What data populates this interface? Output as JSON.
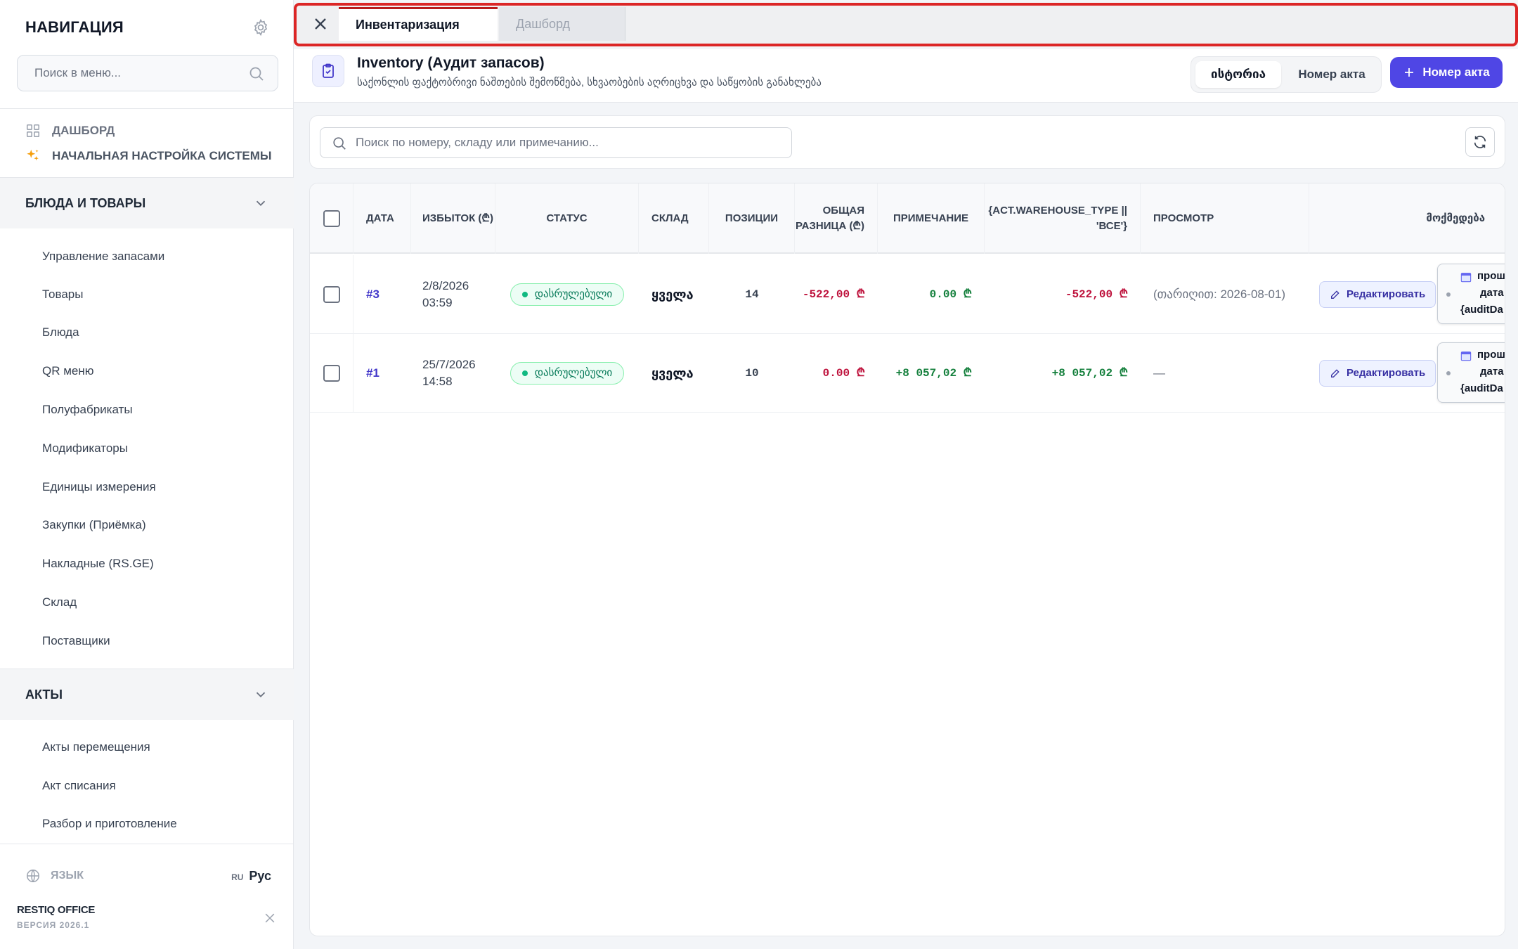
{
  "sidebar": {
    "title": "НАВИГАЦИЯ",
    "search_placeholder": "Поиск в меню...",
    "quick_links": [
      {
        "label": "ДАШБОРД",
        "icon": "grid-icon"
      },
      {
        "label": "НАЧАЛЬНАЯ НАСТРОЙКА СИСТЕМЫ",
        "icon": "sparkles-icon"
      }
    ],
    "sections": [
      {
        "label": "БЛЮДА И ТОВАРЫ",
        "items": [
          "Управление запасами",
          "Товары",
          "Блюда",
          "QR меню",
          "Полуфабрикаты",
          "Модификаторы",
          "Единицы измерения",
          "Закупки (Приёмка)",
          "Накладные (RS.GE)",
          "Склад",
          "Поставщики"
        ]
      },
      {
        "label": "АКТЫ",
        "items": [
          "Акты перемещения",
          "Акт списания",
          "Разбор и приготовление"
        ]
      }
    ],
    "language_label": "ЯЗЫК",
    "language_code": "RU",
    "language_name": "Рус",
    "brand": "RESTIQ OFFICE",
    "version": "ВЕРСИЯ 2026.1"
  },
  "tabs": [
    {
      "label": "Инвентаризация",
      "active": true
    },
    {
      "label": "Дашборд",
      "active": false
    }
  ],
  "header": {
    "title": "Inventory (Аудит запасов)",
    "subtitle": "საქონლის ფაქტობრივი ნაშთების შემოწმება, სხვაობების აღრიცხვა და საწყობის განახლება",
    "segment_options": [
      "ისტორია",
      "Номер акта"
    ],
    "primary_button": "Номер акта"
  },
  "filter": {
    "search_placeholder": "Поиск по номеру, складу или примечанию..."
  },
  "table": {
    "columns": [
      "ДАТА",
      "ИЗБЫТОК (₾)",
      "СТАТУС",
      "СКЛАД",
      "ПОЗИЦИИ",
      "ОБЩАЯ РАЗНИЦА (₾)",
      "ПРИМЕЧАНИЕ",
      "{ACT.WAREHOUSE_TYPE || 'ВСЕ'}",
      "ПРОСМОТР",
      "მოქმედება"
    ],
    "rows": [
      {
        "id": "#3",
        "date": "2/8/2026",
        "time": "03:59",
        "status": "დასრულებული",
        "warehouse": "ყველა",
        "positions": "14",
        "surplus": "-522,00 ₾",
        "total_diff": "0.00 ₾",
        "note": "-522,00 ₾",
        "view": "(თარიღით: 2026-08-01)",
        "edit_label": "Редактировать",
        "extra_label_1": "прош",
        "extra_label_2": "дата",
        "extra_label_3": "{auditDa"
      },
      {
        "id": "#1",
        "date": "25/7/2026",
        "time": "14:58",
        "status": "დასრულებული",
        "warehouse": "ყველა",
        "positions": "10",
        "surplus": "0.00 ₾",
        "total_diff": "+8 057,02 ₾",
        "note": "+8 057,02 ₾",
        "view": "—",
        "edit_label": "Редактировать",
        "extra_label_1": "прош",
        "extra_label_2": "дата",
        "extra_label_3": "{auditDa"
      }
    ]
  },
  "colors": {
    "accent": "#4f46e5",
    "negative": "#be123c",
    "positive": "#15803d",
    "status_green": "#047857",
    "highlight_border": "#dc2626"
  }
}
